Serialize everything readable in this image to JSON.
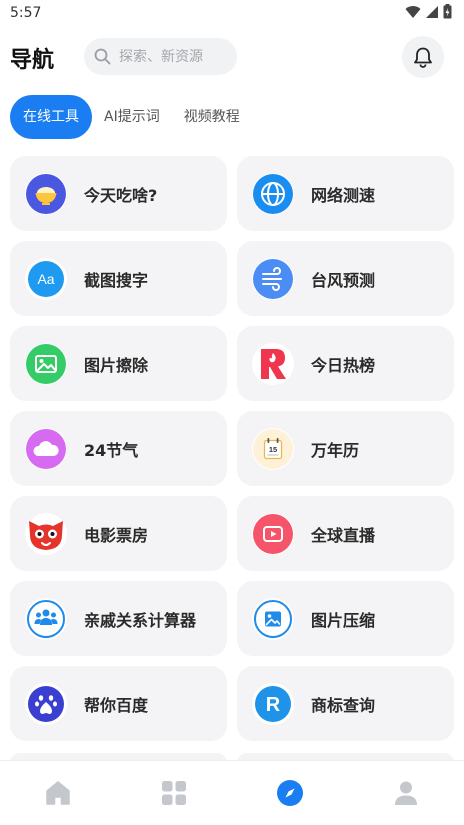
{
  "status": {
    "time": "5:57"
  },
  "header": {
    "title": "导航",
    "search_placeholder": "探索、新资源"
  },
  "tabs": [
    {
      "label": "在线工具",
      "active": true
    },
    {
      "label": "AI提示词",
      "active": false
    },
    {
      "label": "视频教程",
      "active": false
    }
  ],
  "tools": [
    {
      "label": "今天吃啥?",
      "icon": "rice-bowl-icon"
    },
    {
      "label": "网络测速",
      "icon": "globe-icon"
    },
    {
      "label": "截图搜字",
      "icon": "text-aa-icon"
    },
    {
      "label": "台风预测",
      "icon": "wind-icon"
    },
    {
      "label": "图片擦除",
      "icon": "image-erase-icon"
    },
    {
      "label": "今日热榜",
      "icon": "hot-list-icon"
    },
    {
      "label": "24节气",
      "icon": "cloud-icon"
    },
    {
      "label": "万年历",
      "icon": "calendar-icon"
    },
    {
      "label": "电影票房",
      "icon": "cat-face-icon"
    },
    {
      "label": "全球直播",
      "icon": "live-play-icon"
    },
    {
      "label": "亲戚关系计算器",
      "icon": "relatives-icon"
    },
    {
      "label": "图片压缩",
      "icon": "image-compress-icon"
    },
    {
      "label": "帮你百度",
      "icon": "paw-icon"
    },
    {
      "label": "商标查询",
      "icon": "trademark-icon"
    }
  ],
  "calendar_icon_day": "15",
  "trademark_letter": "R",
  "text_icon_letters": "Aa",
  "bottom_nav": [
    {
      "name": "home",
      "active": false
    },
    {
      "name": "apps",
      "active": false
    },
    {
      "name": "discover",
      "active": true
    },
    {
      "name": "profile",
      "active": false
    }
  ],
  "colors": {
    "accent": "#1a7ef2",
    "card_bg": "#f4f4f6",
    "nav_inactive": "#c4c7cc"
  }
}
